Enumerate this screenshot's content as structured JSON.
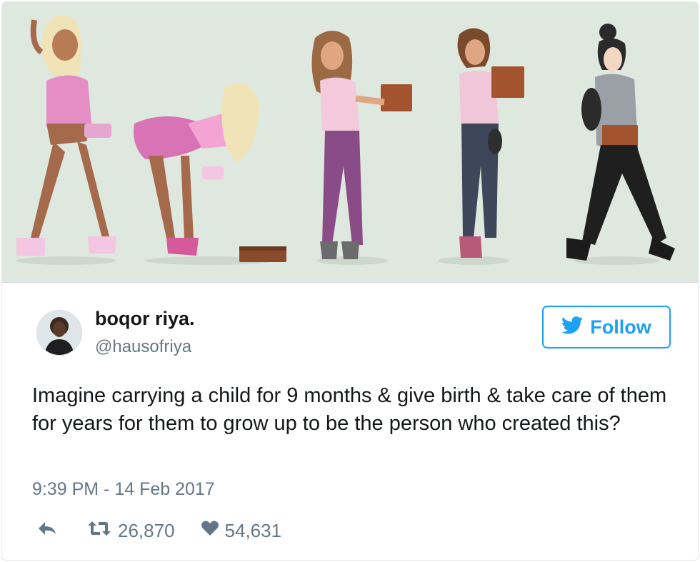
{
  "tweet": {
    "name": "boqor riya.",
    "handle": "@hausofriya",
    "follow_label": "Follow",
    "text": "Imagine carrying a child for 9 months & give birth & take care of them for years for them to grow up to be the person who created this?",
    "timestamp": "9:39 PM - 14 Feb 2017",
    "retweets": "26,870",
    "likes": "54,631"
  },
  "icons": {
    "follow": "twitter-bird-icon",
    "reply": "reply-icon",
    "retweet": "retweet-icon",
    "like": "heart-icon"
  },
  "colors": {
    "accent": "#1da1f2",
    "secondary_text": "#657786",
    "primary_text": "#14171a",
    "media_background": "#dfe8df"
  }
}
